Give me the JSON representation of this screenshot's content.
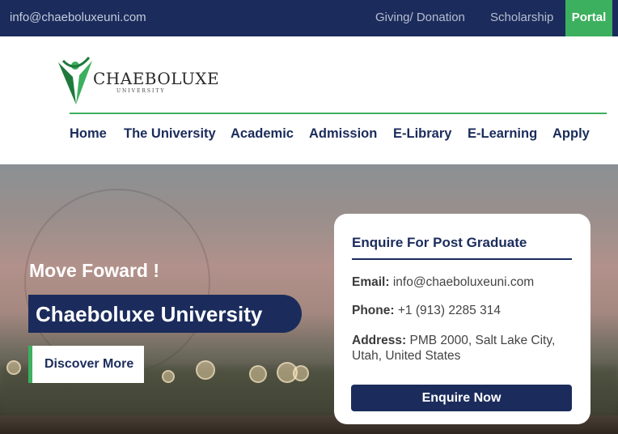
{
  "topbar": {
    "email": "info@chaeboluxeuni.com",
    "links": [
      "Giving/ Donation",
      "Scholarship"
    ],
    "portal_label": "Portal"
  },
  "logo": {
    "name": "CHAEBOLUXE",
    "sub": "UNIVERSITY"
  },
  "nav": [
    "Home",
    "The University",
    "Academic",
    "Admission",
    "E-Library",
    "E-Learning",
    "Apply"
  ],
  "hero": {
    "tagline": "Move Foward !",
    "title": "Chaeboluxe University",
    "cta_label": "Discover More"
  },
  "enquiry": {
    "title": "Enquire For Post Graduate",
    "email_label": "Email:",
    "email_value": "info@chaeboluxeuni.com",
    "phone_label": "Phone:",
    "phone_value": "+1 (913) 2285 314",
    "address_label": "Address:",
    "address_value": "PMB 2000, Salt Lake City, Utah, United States",
    "button_label": "Enquire Now"
  },
  "colors": {
    "navy": "#1b2c5c",
    "green": "#3cb05e"
  },
  "icons": [
    "logo-figure-icon"
  ]
}
